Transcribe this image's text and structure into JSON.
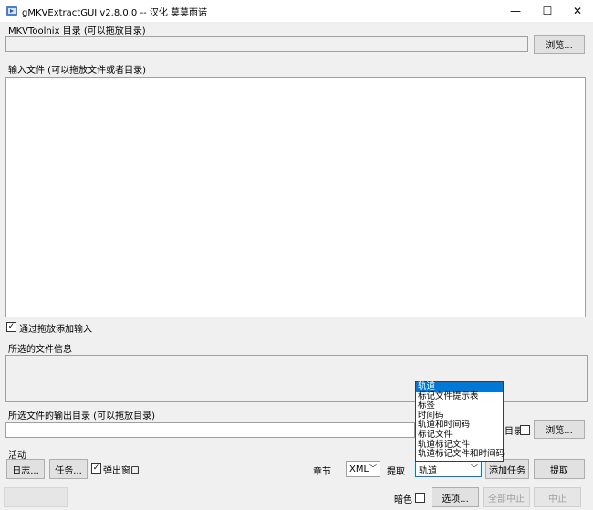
{
  "window": {
    "title": "gMKVExtractGUI v2.8.0.0 -- 汉化 莫莫雨诺",
    "minimize_glyph": "—",
    "maximize_glyph": "☐",
    "close_glyph": "✕"
  },
  "mkvtoolnix": {
    "label": "MKVToolnix 目录 (可以拖放目录)",
    "value": "",
    "browse_label": "浏览..."
  },
  "input": {
    "label": "输入文件 (可以拖放文件或者目录)",
    "append_on_drop_label": "通过拖放添加输入",
    "append_on_drop_checked": true
  },
  "file_info": {
    "label": "所选的文件信息"
  },
  "output": {
    "label": "所选文件的输出目录 (可以拖放目录)",
    "value": "",
    "use_source_label": "目录",
    "use_source_checked": false,
    "browse_label": "浏览..."
  },
  "actions": {
    "label": "活动",
    "log_label": "日志...",
    "jobs_label": "任务...",
    "popup_label": "弹出窗口",
    "popup_checked": true,
    "chapters_label": "章节",
    "chapters_value": "XML",
    "extract_label": "提取",
    "extract_value": "轨道",
    "add_job_label": "添加任务",
    "extract_button_label": "提取",
    "extract_options": [
      "轨道",
      "标记文件提示表",
      "标签",
      "时间码",
      "轨道和时间码",
      "标记文件",
      "轨道标记文件",
      "轨道标记文件和时间码"
    ]
  },
  "bottom": {
    "dark_mode_label": "暗色",
    "dark_mode_checked": false,
    "options_label": "选项...",
    "abort_all_label": "全部中止",
    "abort_label": "中止"
  }
}
